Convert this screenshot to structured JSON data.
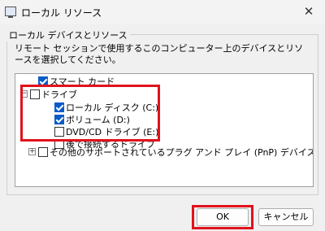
{
  "window": {
    "title": "ローカル リソース",
    "close_glyph": "✕"
  },
  "group": {
    "legend": "ローカル デバイスとリソース",
    "description": "リモート セッションで使用するこのコンピューター上のデバイスとリソースを選択してください。"
  },
  "tree": {
    "smartcard": {
      "label": "スマート カード",
      "checked": true
    },
    "drives": {
      "label": "ドライブ",
      "expander": "−",
      "checked": false,
      "children": [
        {
          "label": "ローカル ディスク (C:)",
          "checked": true
        },
        {
          "label": "ボリューム (D:)",
          "checked": true
        },
        {
          "label": "DVD/CD ドライブ (E:)",
          "checked": false
        },
        {
          "label": "後で接続するドライブ",
          "checked": false
        }
      ]
    },
    "other": {
      "label": "その他のサポートされているプラグ アンド プレイ (PnP) デバイス",
      "expander": "+",
      "checked": false
    }
  },
  "buttons": {
    "ok": "OK",
    "cancel": "キャンセル"
  },
  "colors": {
    "highlight": "#e0121d",
    "checkbox": "#0b5cc7"
  }
}
